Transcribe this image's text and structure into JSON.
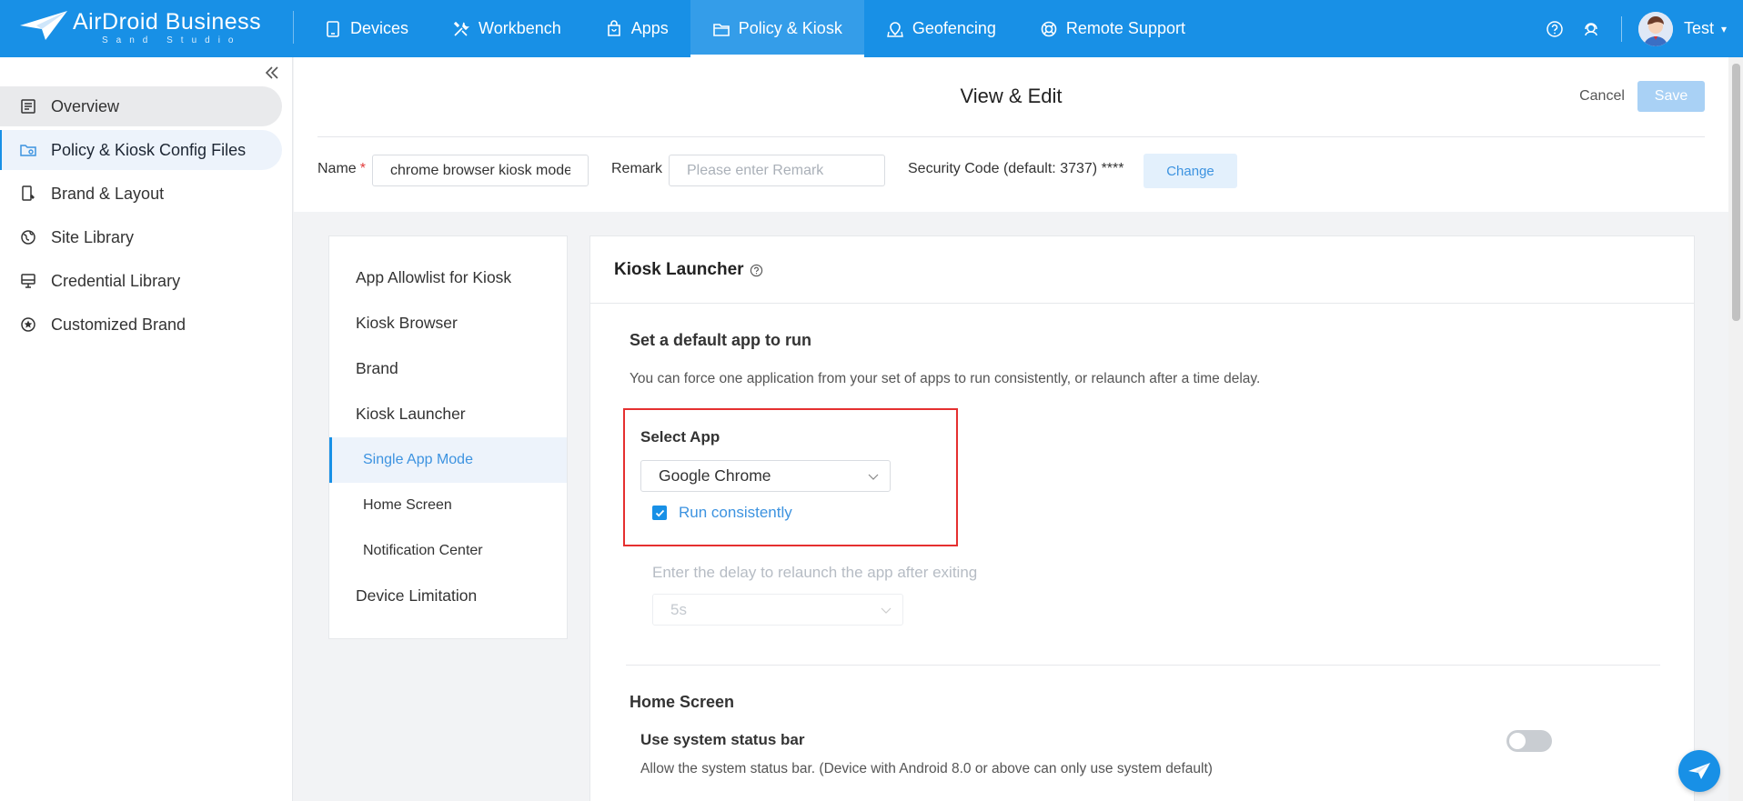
{
  "brand": {
    "name": "AirDroid Business",
    "sub": "Sand Studio"
  },
  "nav": {
    "items": [
      {
        "label": "Devices",
        "icon": "tablet-icon"
      },
      {
        "label": "Workbench",
        "icon": "tools-icon"
      },
      {
        "label": "Apps",
        "icon": "bag-icon"
      },
      {
        "label": "Policy & Kiosk",
        "icon": "folder-icon"
      },
      {
        "label": "Geofencing",
        "icon": "map-pin-icon"
      },
      {
        "label": "Remote Support",
        "icon": "lifebuoy-icon"
      }
    ],
    "active": "Policy & Kiosk"
  },
  "user": {
    "name": "Test"
  },
  "sidebar": {
    "items": [
      {
        "label": "Overview",
        "icon": "document-icon"
      },
      {
        "label": "Policy & Kiosk Config Files",
        "icon": "folder-gear-icon"
      },
      {
        "label": "Brand & Layout",
        "icon": "device-brush-icon"
      },
      {
        "label": "Site Library",
        "icon": "globe-icon"
      },
      {
        "label": "Credential Library",
        "icon": "monitor-icon"
      },
      {
        "label": "Customized Brand",
        "icon": "star-circle-icon"
      }
    ]
  },
  "header": {
    "title": "View & Edit",
    "cancel_label": "Cancel",
    "save_label": "Save",
    "name_label": "Name",
    "name_value": "chrome browser kiosk mode",
    "remark_label": "Remark",
    "remark_placeholder": "Please enter Remark",
    "security_text": "Security Code (default: 3737) ****",
    "change_label": "Change"
  },
  "inner_nav": {
    "items": [
      "App Allowlist for Kiosk",
      "Kiosk Browser",
      "Brand",
      "Kiosk Launcher",
      "Single App Mode",
      "Home Screen",
      "Notification Center",
      "Device Limitation"
    ],
    "active": "Single App Mode"
  },
  "content": {
    "section_title": "Kiosk Launcher",
    "default_app_title": "Set a default app to run",
    "default_app_desc": "You can force one application from your set of apps to run consistently, or relaunch after a time delay.",
    "select_app_label": "Select App",
    "selected_app": "Google Chrome",
    "run_consistently_label": "Run consistently",
    "run_consistently_checked": true,
    "delay_label": "Enter the delay to relaunch the app after exiting",
    "delay_value": "5s",
    "home_screen_title": "Home Screen",
    "status_bar_title": "Use system status bar",
    "status_bar_desc": "Allow the system status bar. (Device with Android 8.0 or above can only use system default)",
    "status_bar_enabled": false
  },
  "colors": {
    "primary": "#1890e6",
    "highlight_box": "#e53030"
  }
}
